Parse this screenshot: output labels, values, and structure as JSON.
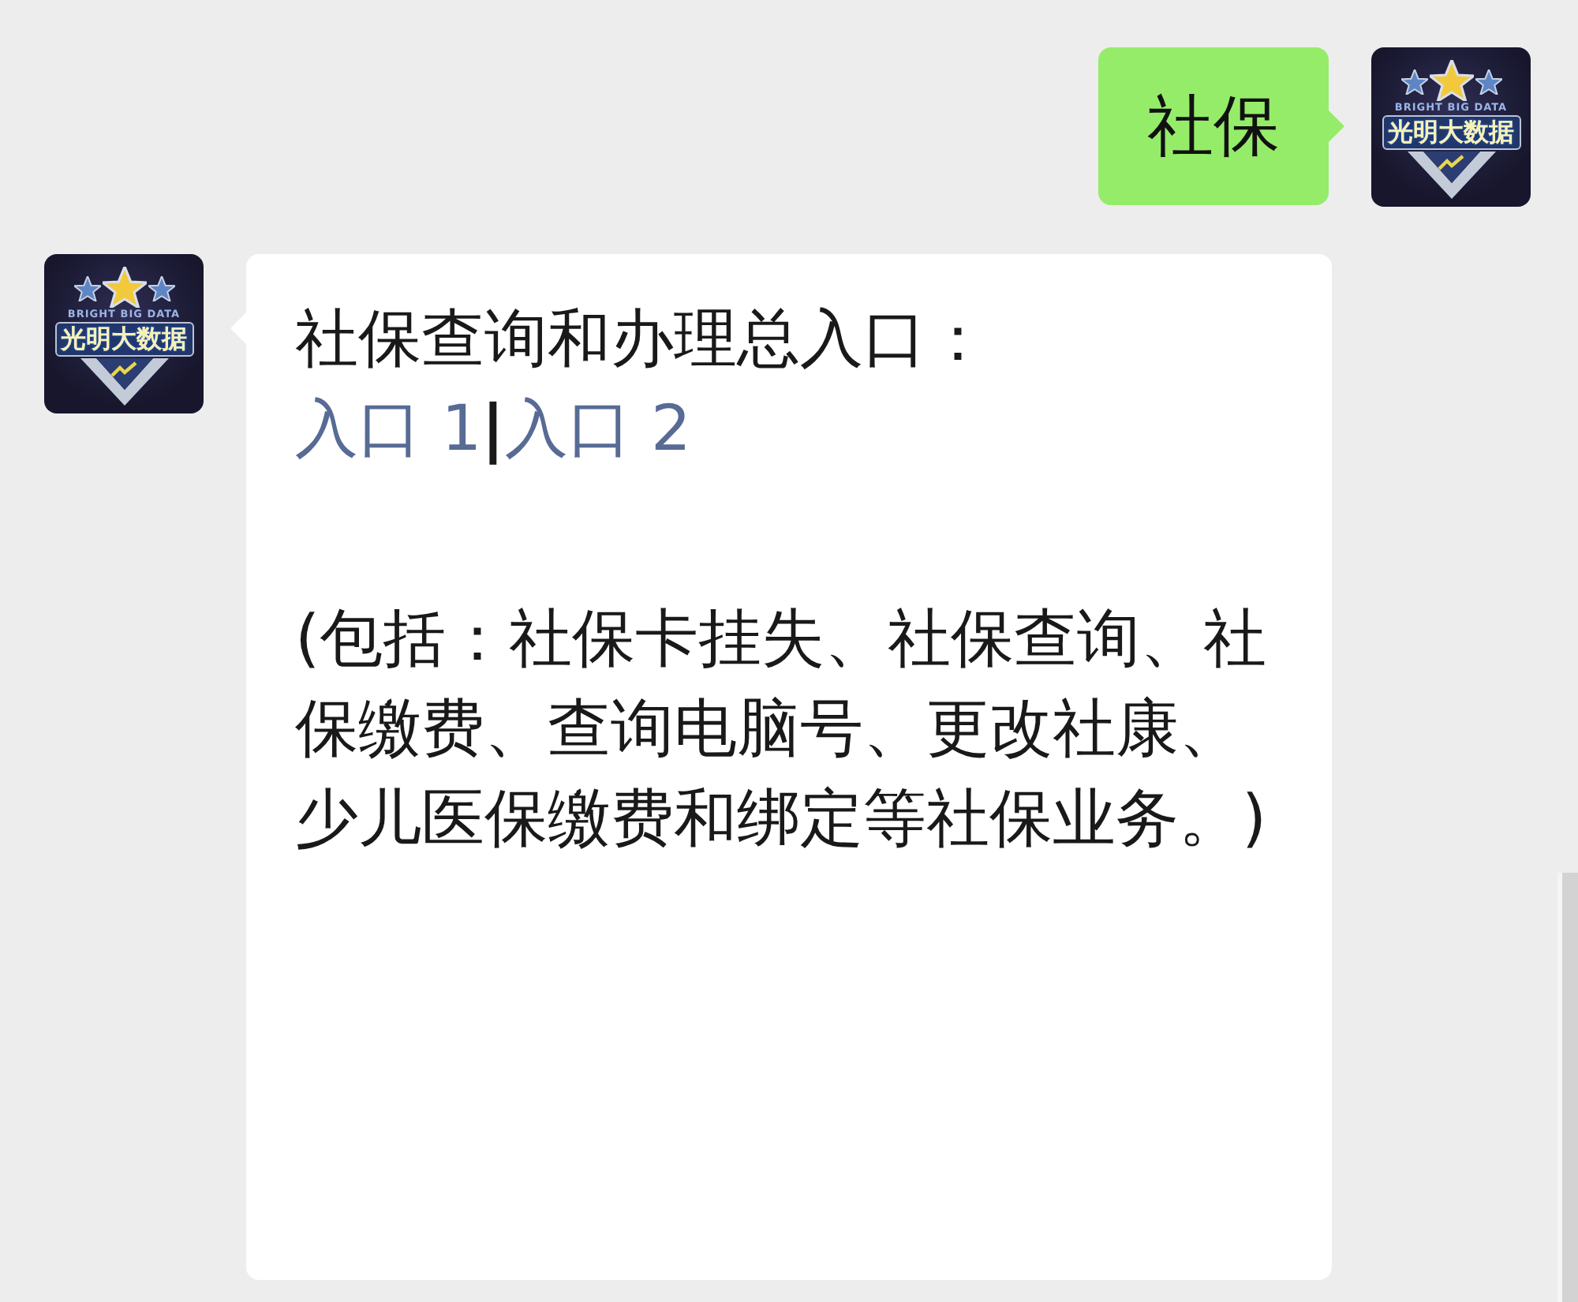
{
  "messages": [
    {
      "kind": "outgoing",
      "avatar": {
        "subtitle": "BRIGHT BIG DATA",
        "title": "光明大数据"
      },
      "text": "社保"
    },
    {
      "kind": "incoming",
      "avatar": {
        "subtitle": "BRIGHT BIG DATA",
        "title": "光明大数据"
      },
      "heading": "社保查询和办理总入口：",
      "links": [
        {
          "label": "入口 1"
        },
        {
          "label": "入口 2"
        }
      ],
      "separator": "|",
      "note": "(包括：社保卡挂失、社保查询、社保缴费、查询电脑号、更改社康、少儿医保缴费和绑定等社保业务。)"
    }
  ]
}
